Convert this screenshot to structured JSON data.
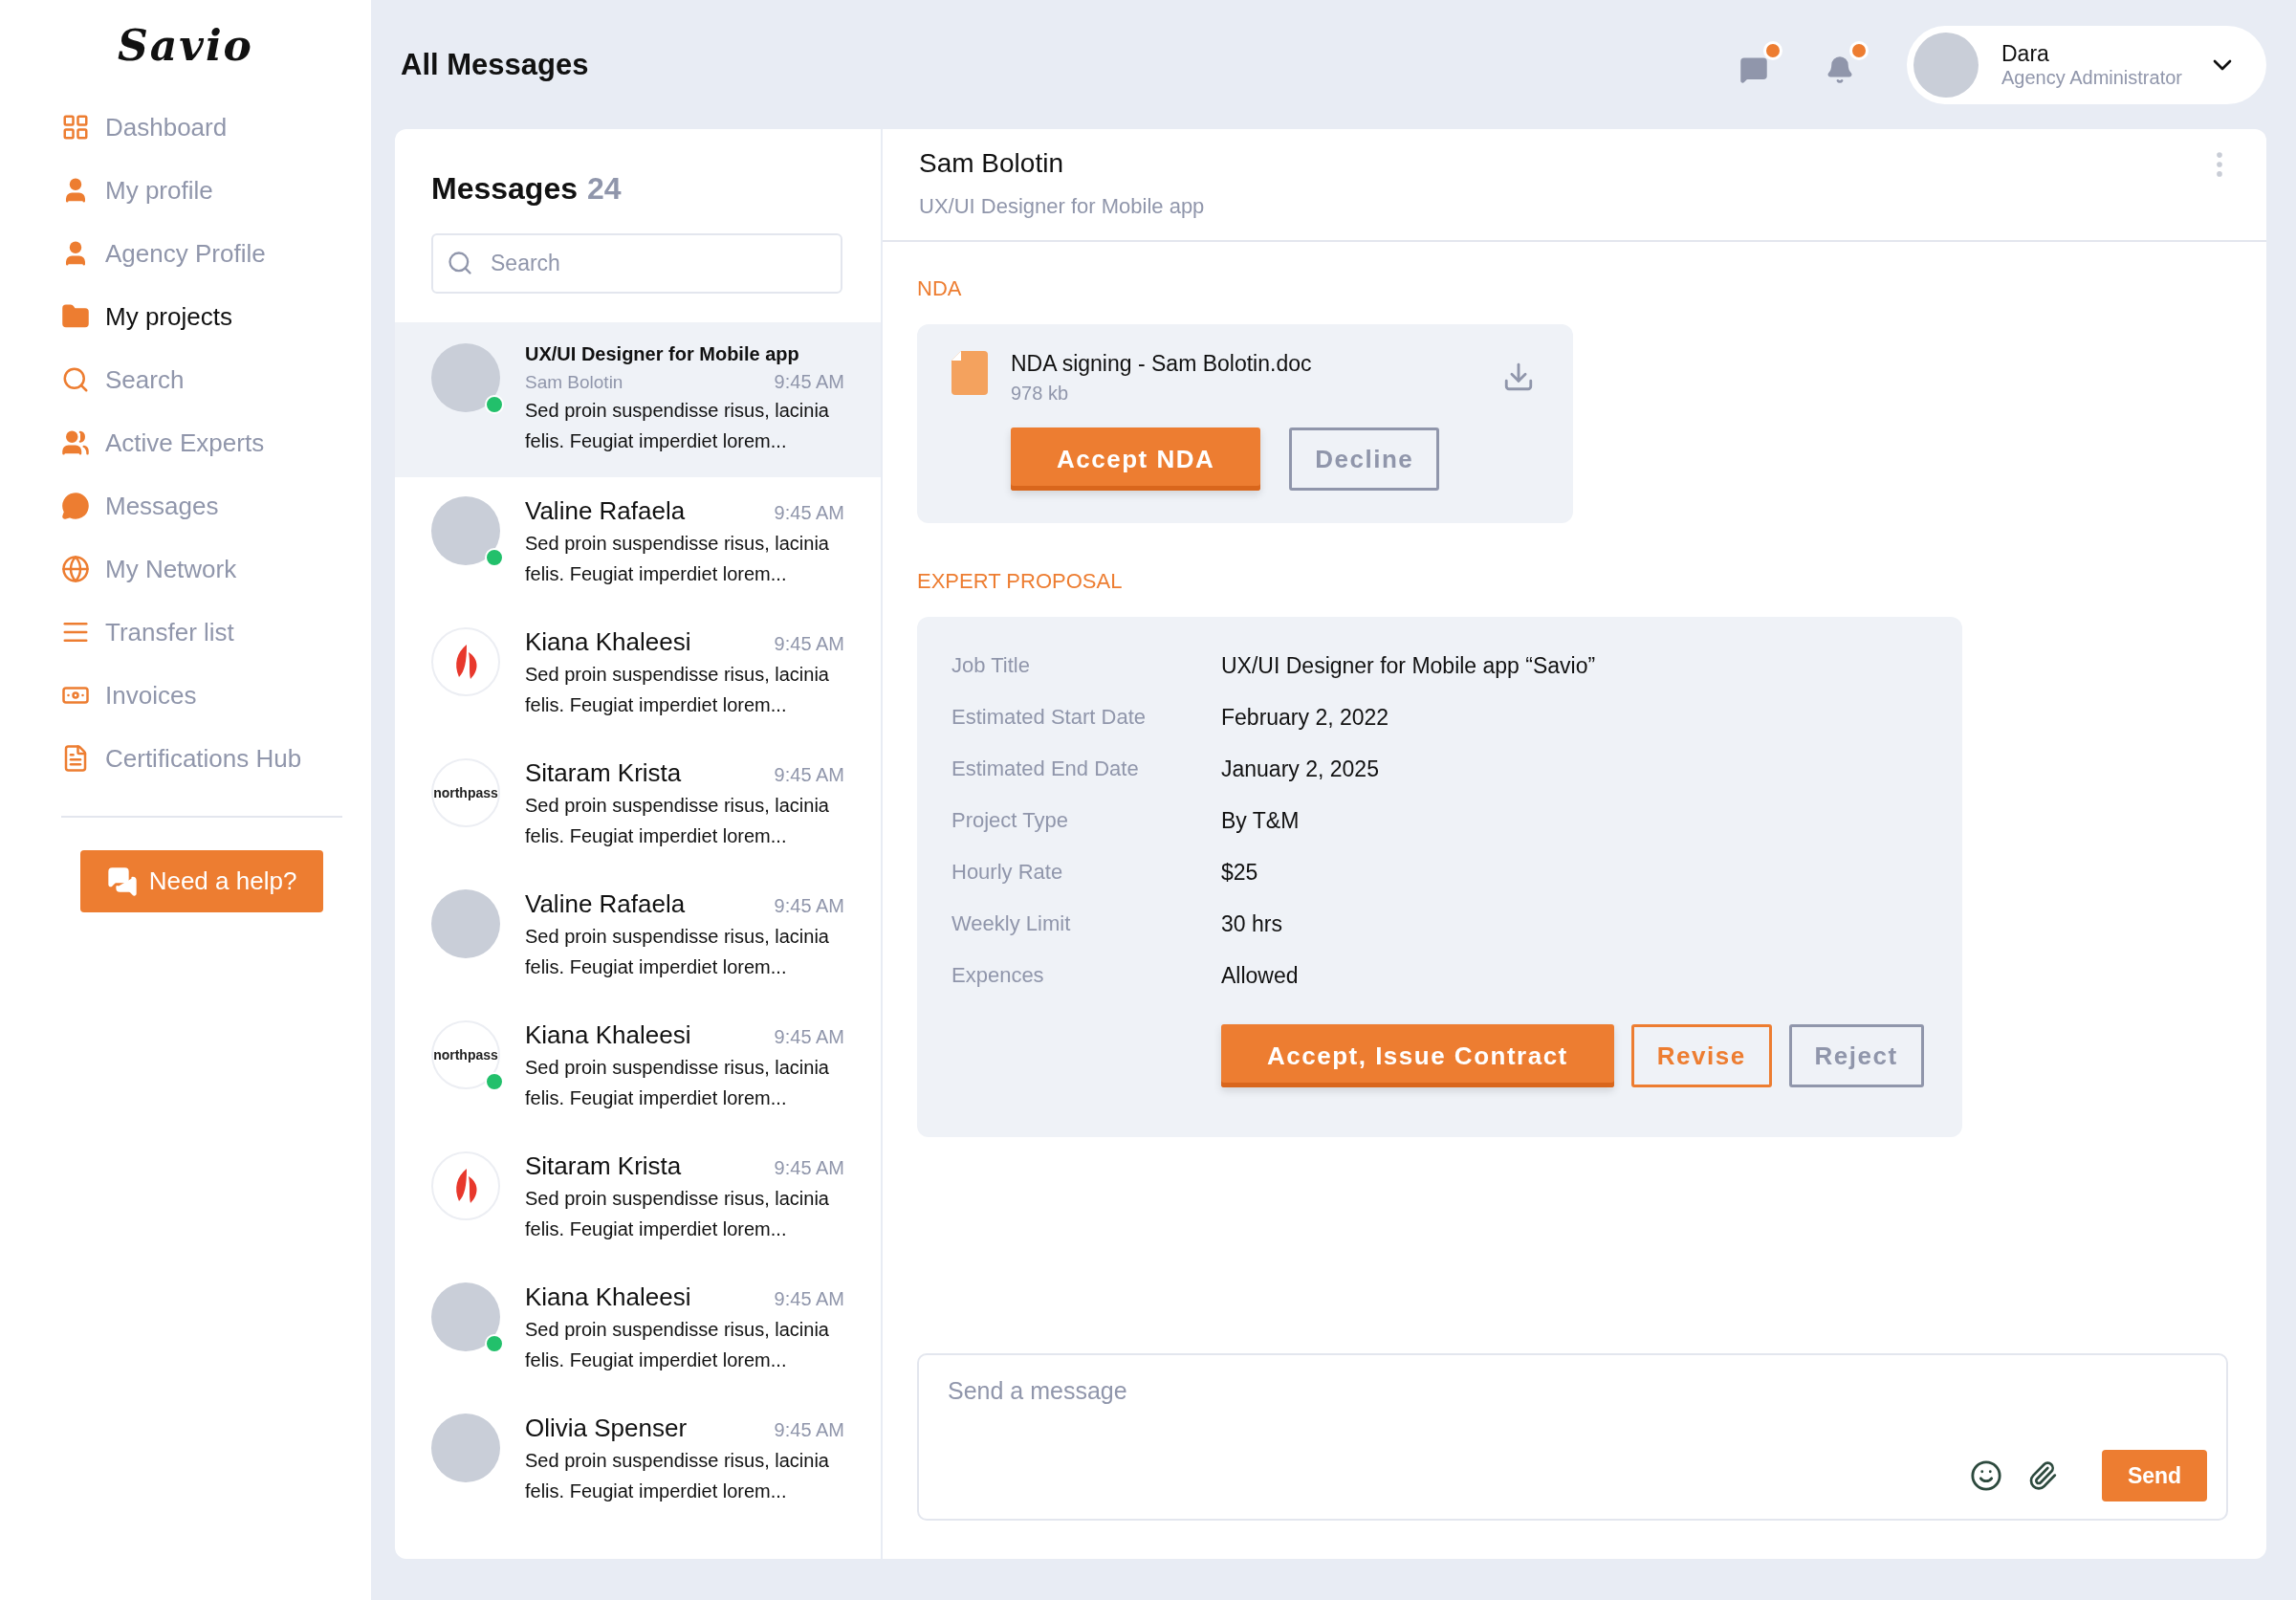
{
  "logo": "Savio",
  "sidebar": {
    "items": [
      {
        "label": "Dashboard",
        "selected": false
      },
      {
        "label": "My profile",
        "selected": false
      },
      {
        "label": "Agency Profile",
        "selected": false
      },
      {
        "label": "My projects",
        "selected": true
      },
      {
        "label": "Search",
        "selected": false
      },
      {
        "label": "Active Experts",
        "selected": false
      },
      {
        "label": "Messages",
        "selected": false
      },
      {
        "label": "My Network",
        "selected": false
      },
      {
        "label": "Transfer list",
        "selected": false
      },
      {
        "label": "Invoices",
        "selected": false
      },
      {
        "label": "Certifications Hub",
        "selected": false
      }
    ],
    "help_button": "Need a help?"
  },
  "header": {
    "title": "All Messages",
    "notifications": [
      {
        "kind": "chat",
        "badge": true
      },
      {
        "kind": "bell",
        "badge": true
      }
    ],
    "user": {
      "name": "Dara",
      "role": "Agency Administrator"
    }
  },
  "messages": {
    "title": "Messages",
    "count": "24",
    "search": {
      "placeholder": "Search"
    },
    "items": [
      {
        "kind": "project",
        "title": "UX/UI Designer for Mobile app",
        "name": "Sam Bolotin",
        "time": "9:45 AM",
        "preview": "Sed proin suspendisse risus, lacinia felis. Feugiat imperdiet lorem...",
        "avatar": {
          "kind": "photo"
        },
        "online": true,
        "selected": true
      },
      {
        "kind": "person",
        "name": "Valine Rafaela",
        "time": "9:45 AM",
        "preview": "Sed proin suspendisse risus, lacinia felis. Feugiat imperdiet lorem...",
        "avatar": {
          "kind": "photo"
        },
        "online": true,
        "selected": false
      },
      {
        "kind": "person",
        "name": "Kiana Khaleesi",
        "time": "9:45 AM",
        "preview": "Sed proin suspendisse risus, lacinia felis. Feugiat imperdiet lorem...",
        "avatar": {
          "kind": "leaf"
        },
        "online": false,
        "selected": false
      },
      {
        "kind": "person",
        "name": "Sitaram Krista",
        "time": "9:45 AM",
        "preview": "Sed proin suspendisse risus, lacinia felis. Feugiat imperdiet lorem...",
        "avatar": {
          "kind": "wordmark",
          "text": "northpass"
        },
        "online": false,
        "selected": false
      },
      {
        "kind": "person",
        "name": "Valine Rafaela",
        "time": "9:45 AM",
        "preview": "Sed proin suspendisse risus, lacinia felis. Feugiat imperdiet lorem...",
        "avatar": {
          "kind": "photo"
        },
        "online": false,
        "selected": false
      },
      {
        "kind": "person",
        "name": "Kiana Khaleesi",
        "time": "9:45 AM",
        "preview": "Sed proin suspendisse risus, lacinia felis. Feugiat imperdiet lorem...",
        "avatar": {
          "kind": "wordmark",
          "text": "northpass"
        },
        "online": true,
        "selected": false
      },
      {
        "kind": "person",
        "name": "Sitaram Krista",
        "time": "9:45 AM",
        "preview": "Sed proin suspendisse risus, lacinia felis. Feugiat imperdiet lorem...",
        "avatar": {
          "kind": "leaf"
        },
        "online": false,
        "selected": false
      },
      {
        "kind": "person",
        "name": "Kiana Khaleesi",
        "time": "9:45 AM",
        "preview": "Sed proin suspendisse risus, lacinia felis. Feugiat imperdiet lorem...",
        "avatar": {
          "kind": "photo"
        },
        "online": true,
        "selected": false
      },
      {
        "kind": "person",
        "name": "Olivia Spenser",
        "time": "9:45 AM",
        "preview": "Sed proin suspendisse risus, lacinia felis. Feugiat imperdiet lorem...",
        "avatar": {
          "kind": "photo"
        },
        "online": false,
        "selected": false
      }
    ]
  },
  "chat": {
    "name": "Sam Bolotin",
    "subtitle": "UX/UI Designer for Mobile app",
    "nda": {
      "label": "NDA",
      "file_name": "NDA signing - Sam Bolotin.doc",
      "file_size": "978 kb",
      "buttons": [
        {
          "label": "Accept NDA",
          "kind": "primary"
        },
        {
          "label": "Decline",
          "kind": "muted"
        }
      ]
    },
    "proposal": {
      "label": "EXPERT PROPOSAL",
      "rows": [
        {
          "label": "Job Title",
          "value": "UX/UI Designer for Mobile app “Savio”"
        },
        {
          "label": "Estimated Start Date",
          "value": "February 2, 2022"
        },
        {
          "label": "Estimated End Date",
          "value": "January 2, 2025"
        },
        {
          "label": "Project Type",
          "value": "By T&M"
        },
        {
          "label": "Hourly Rate",
          "value": "$25"
        },
        {
          "label": "Weekly Limit",
          "value": "30 hrs"
        },
        {
          "label": "Expences",
          "value": "Allowed"
        }
      ],
      "buttons": [
        {
          "label": "Accept, Issue Contract",
          "kind": "primary"
        },
        {
          "label": "Revise",
          "kind": "outline"
        },
        {
          "label": "Reject",
          "kind": "muted"
        }
      ]
    },
    "composer": {
      "placeholder": "Send a message",
      "send": "Send"
    }
  }
}
